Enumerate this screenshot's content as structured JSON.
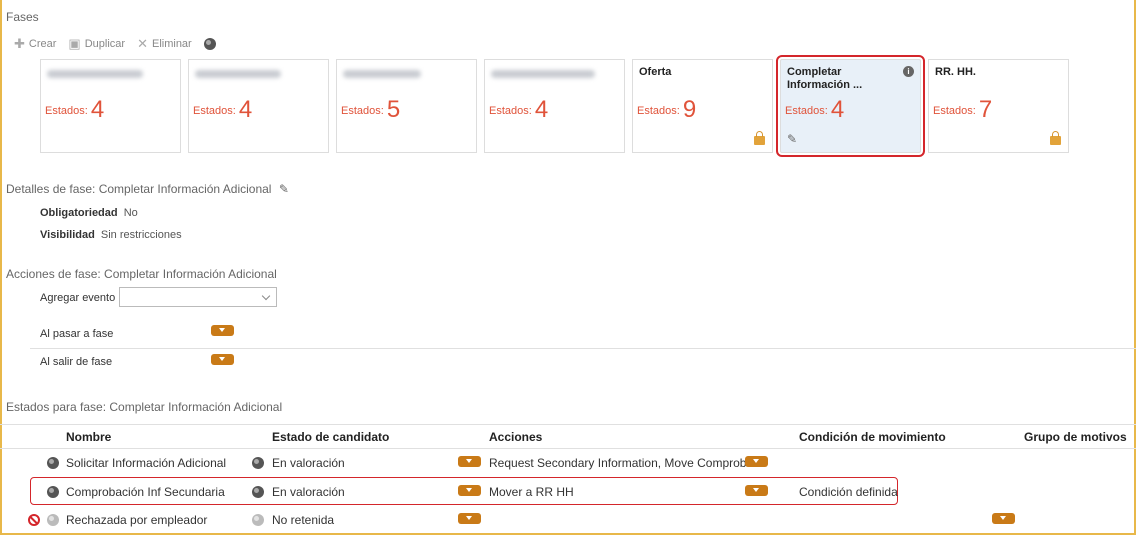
{
  "sections": {
    "fases": "Fases",
    "detalles": "Detalles de fase: Completar Información Adicional",
    "acciones": "Acciones de fase: Completar Información Adicional",
    "estados": "Estados para fase: Completar Información Adicional"
  },
  "toolbar": {
    "crear": "Crear",
    "duplicar": "Duplicar",
    "eliminar": "Eliminar"
  },
  "cards": [
    {
      "title": "",
      "states_label": "Estados:",
      "count": "4"
    },
    {
      "title": "",
      "states_label": "Estados:",
      "count": "4"
    },
    {
      "title": "",
      "states_label": "Estados:",
      "count": "5"
    },
    {
      "title": "",
      "states_label": "Estados:",
      "count": "4"
    },
    {
      "title": "Oferta",
      "states_label": "Estados:",
      "count": "9"
    },
    {
      "title": "Completar Información ...",
      "states_label": "Estados:",
      "count": "4"
    },
    {
      "title": "RR. HH.",
      "states_label": "Estados:",
      "count": "7"
    }
  ],
  "details": {
    "obligatoriedad_label": "Obligatoriedad",
    "obligatoriedad_value": "No",
    "visibilidad_label": "Visibilidad",
    "visibilidad_value": "Sin restricciones"
  },
  "actions": {
    "agregar_evento": "Agregar evento",
    "al_pasar": "Al pasar a fase",
    "al_salir": "Al salir de fase"
  },
  "table": {
    "headers": [
      "Nombre",
      "Estado de candidato",
      "Acciones",
      "Condición de movimiento",
      "Grupo de motivos"
    ],
    "rows": [
      {
        "nombre": "Solicitar Información Adicional",
        "estado": "En valoración",
        "acciones": "Request Secondary Information, Move Comprob...",
        "condicion": ""
      },
      {
        "nombre": "Comprobación Inf Secundaria",
        "estado": "En valoración",
        "acciones": "Mover a RR HH",
        "condicion": "Condición definida"
      },
      {
        "nombre": "Rechazada por empleador",
        "estado": "No retenida",
        "acciones": "",
        "condicion": ""
      }
    ]
  },
  "colors": {
    "accent": "#e0533a",
    "highlight": "#d4262b",
    "dropdown": "#c97a17"
  }
}
